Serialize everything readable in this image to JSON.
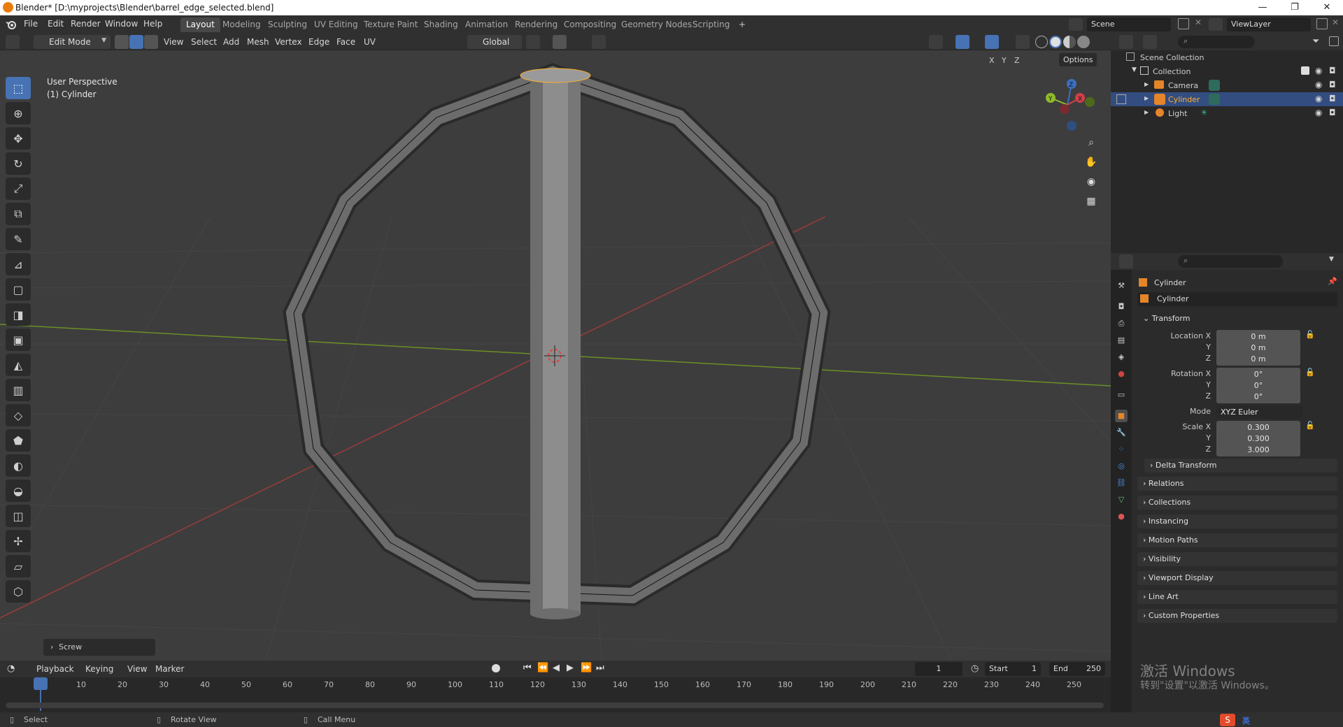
{
  "window": {
    "title": "Blender* [D:\\myprojects\\Blender\\barrel_edge_selected.blend]",
    "controls": {
      "minimize": "—",
      "maximize": "❐",
      "close": "✕"
    }
  },
  "menubar": {
    "items": [
      "File",
      "Edit",
      "Render",
      "Window",
      "Help"
    ],
    "workspaces": [
      "Layout",
      "Modeling",
      "Sculpting",
      "UV Editing",
      "Texture Paint",
      "Shading",
      "Animation",
      "Rendering",
      "Compositing",
      "Geometry Nodes",
      "Scripting"
    ],
    "active_workspace": "Layout",
    "add_tab": "+",
    "scene": "Scene",
    "view_layer": "ViewLayer"
  },
  "viewport_header": {
    "mode": "Edit Mode",
    "menus": [
      "View",
      "Select",
      "Add",
      "Mesh",
      "Vertex",
      "Edge",
      "Face",
      "UV"
    ],
    "orientation": "Global",
    "options": "Options",
    "axes": [
      "X",
      "Y",
      "Z"
    ]
  },
  "viewport": {
    "perspective_label": "User Perspective",
    "object_label": "(1) Cylinder",
    "last_operator": "Screw",
    "gizmo_axes": {
      "z": "Z",
      "y": "Y",
      "x": "X"
    },
    "colors": {
      "background": "#3d3d3d",
      "x_axis": "#9c3b3b",
      "y_axis": "#6b8f26",
      "active": "#4772b3",
      "selected": "#ffaf29"
    }
  },
  "timeline": {
    "menus": [
      "Playback",
      "Keying",
      "View",
      "Marker"
    ],
    "current_frame": "1",
    "start_label": "Start",
    "start": "1",
    "end_label": "End",
    "end": "250",
    "ruler": [
      "1",
      "10",
      "20",
      "30",
      "40",
      "50",
      "60",
      "70",
      "80",
      "90",
      "100",
      "110",
      "120",
      "130",
      "140",
      "150",
      "160",
      "170",
      "180",
      "190",
      "200",
      "210",
      "220",
      "230",
      "240",
      "250"
    ]
  },
  "statusbar": {
    "select": "Select",
    "rotate": "Rotate View",
    "call_menu": "Call Menu",
    "watermark_line1": "激活 Windows",
    "watermark_line2": "转到\"设置\"以激活 Windows。",
    "ime": "英"
  },
  "outliner": {
    "root": "Scene Collection",
    "collection": "Collection",
    "items": [
      {
        "name": "Camera",
        "icon": "camera-icon",
        "selected": false
      },
      {
        "name": "Cylinder",
        "icon": "mesh-icon",
        "selected": true
      },
      {
        "name": "Light",
        "icon": "light-icon",
        "selected": false
      }
    ]
  },
  "properties": {
    "object_name": "Cylinder",
    "datablock": "Cylinder",
    "transform_header": "Transform",
    "location_label": "Location X",
    "location": [
      "0 m",
      "0 m",
      "0 m"
    ],
    "rotation_label": "Rotation X",
    "rotation": [
      "0°",
      "0°",
      "0°"
    ],
    "mode_label": "Mode",
    "mode": "XYZ Euler",
    "scale_label": "Scale X",
    "scale": [
      "0.300",
      "0.300",
      "3.000"
    ],
    "y_label": "Y",
    "z_label": "Z",
    "delta": "Delta Transform",
    "panels": [
      "Relations",
      "Collections",
      "Instancing",
      "Motion Paths",
      "Visibility",
      "Viewport Display",
      "Line Art",
      "Custom Properties"
    ]
  }
}
